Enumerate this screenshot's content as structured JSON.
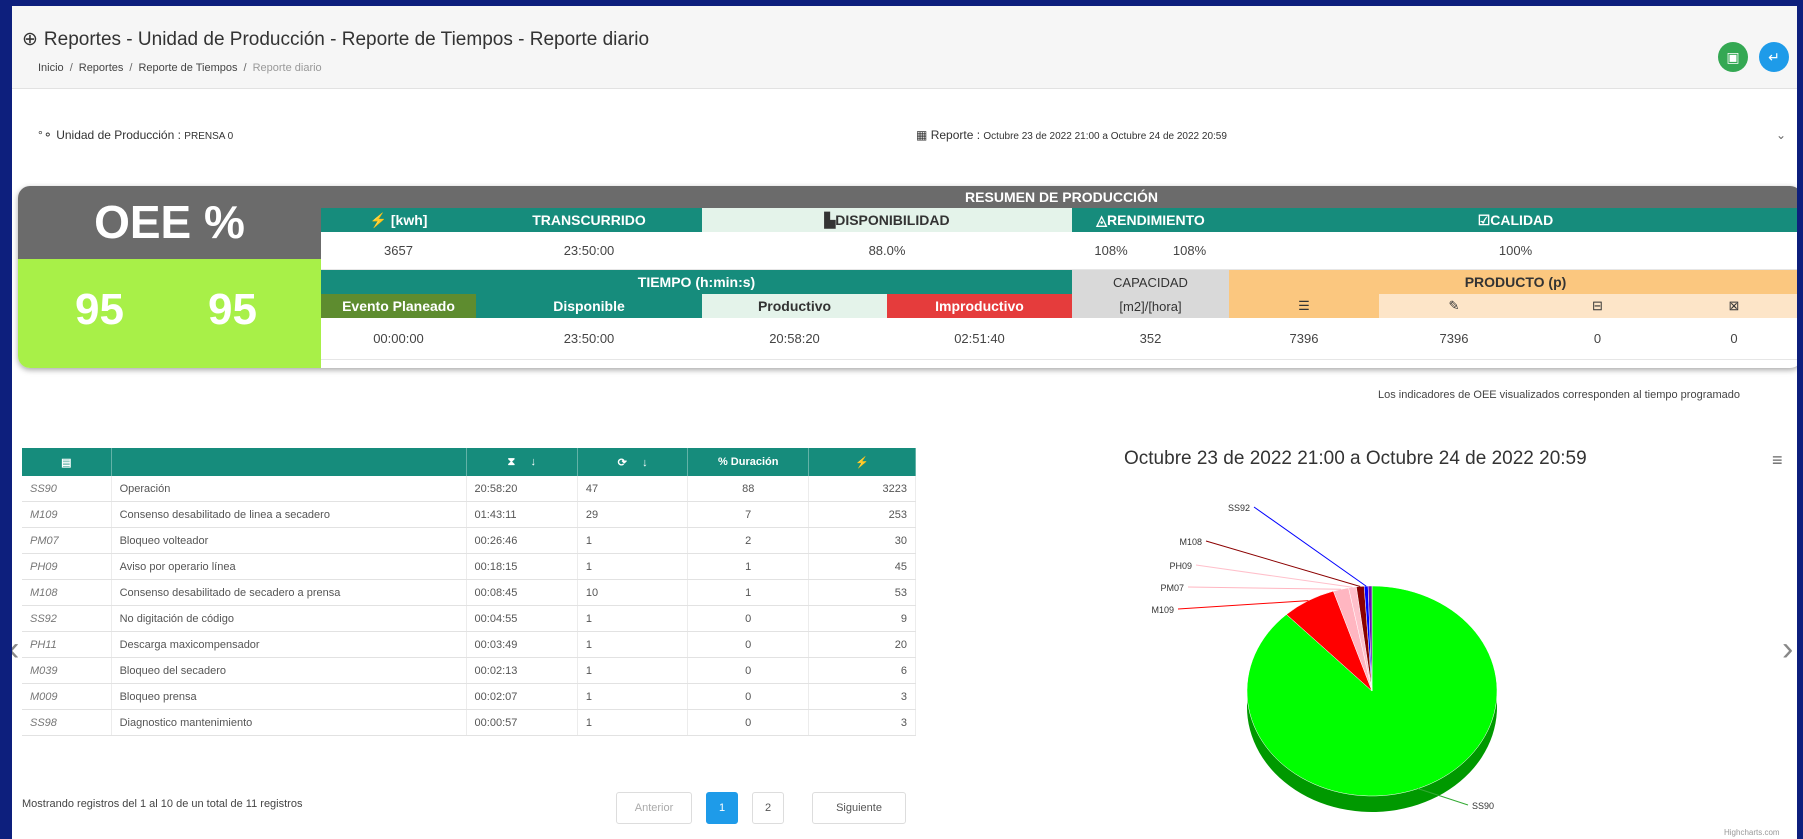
{
  "header": {
    "title": "Reportes - Unidad de Producción - Reporte de Tiempos - Reporte diario",
    "breadcrumb": [
      "Inicio",
      "Reportes",
      "Reporte de Tiempos",
      "Reporte diario"
    ]
  },
  "info": {
    "unit_label": "Unidad de Producción :",
    "unit_value": "PRENSA 0",
    "report_label": "Reporte :",
    "report_value": "Octubre 23 de 2022 21:00 a Octubre 24 de 2022 20:59"
  },
  "summary": {
    "oee_title": "OEE %",
    "oee_values": [
      "95",
      "95"
    ],
    "band_title": "RESUMEN DE PRODUCCIÓN",
    "headers": {
      "energy": "[kwh]",
      "elapsed": "TRANSCURRIDO",
      "availability": "DISPONIBILIDAD",
      "performance": "RENDIMIENTO",
      "quality": "CALIDAD"
    },
    "values": {
      "energy": "3657",
      "elapsed": "23:50:00",
      "availability": "88.0%",
      "performance_a": "108%",
      "performance_b": "108%",
      "quality": "100%"
    },
    "time_title": "TIEMPO (h:min:s)",
    "capacity_title": "CAPACIDAD",
    "capacity_unit": "[m2]/[hora]",
    "product_title": "PRODUCTO (p)",
    "time_headers": {
      "planned": "Evento Planeado",
      "available": "Disponible",
      "productive": "Productivo",
      "unproductive": "Improductivo"
    },
    "time_values": {
      "planned": "00:00:00",
      "available": "23:50:00",
      "productive": "20:58:20",
      "unproductive": "02:51:40"
    },
    "capacity_value": "352",
    "product_values": [
      "7396",
      "7396",
      "0",
      "0"
    ]
  },
  "note": "Los indicadores de OEE visualizados corresponden al tiempo programado",
  "table": {
    "col_pct": "% Duración",
    "rows": [
      {
        "code": "SS90",
        "desc": "Operación",
        "time": "20:58:20",
        "count": "47",
        "pct": "88",
        "energy": "3223"
      },
      {
        "code": "M109",
        "desc": "Consenso desabilitado de linea a secadero",
        "time": "01:43:11",
        "count": "29",
        "pct": "7",
        "energy": "253"
      },
      {
        "code": "PM07",
        "desc": "Bloqueo volteador",
        "time": "00:26:46",
        "count": "1",
        "pct": "2",
        "energy": "30"
      },
      {
        "code": "PH09",
        "desc": "Aviso por operario línea",
        "time": "00:18:15",
        "count": "1",
        "pct": "1",
        "energy": "45"
      },
      {
        "code": "M108",
        "desc": "Consenso desabilitado de secadero a prensa",
        "time": "00:08:45",
        "count": "10",
        "pct": "1",
        "energy": "53"
      },
      {
        "code": "SS92",
        "desc": "No digitación de código",
        "time": "00:04:55",
        "count": "1",
        "pct": "0",
        "energy": "9"
      },
      {
        "code": "PH11",
        "desc": "Descarga maxicompensador",
        "time": "00:03:49",
        "count": "1",
        "pct": "0",
        "energy": "20"
      },
      {
        "code": "M039",
        "desc": "Bloqueo del secadero",
        "time": "00:02:13",
        "count": "1",
        "pct": "0",
        "energy": "6"
      },
      {
        "code": "M009",
        "desc": "Bloqueo prensa",
        "time": "00:02:07",
        "count": "1",
        "pct": "0",
        "energy": "3"
      },
      {
        "code": "SS98",
        "desc": "Diagnostico mantenimiento",
        "time": "00:00:57",
        "count": "1",
        "pct": "0",
        "energy": "3"
      }
    ],
    "showing": "Mostrando registros del 1 al 10 de un total de 11 registros",
    "pager": {
      "prev": "Anterior",
      "p1": "1",
      "p2": "2",
      "next": "Siguiente"
    }
  },
  "chart_data": {
    "type": "pie",
    "title": "Octubre 23 de 2022 21:00 a Octubre 24 de 2022 20:59",
    "credit": "Highcharts.com",
    "slices": [
      {
        "name": "SS90",
        "value": 88,
        "color": "#00ff00"
      },
      {
        "name": "M109",
        "value": 7,
        "color": "#ff0000"
      },
      {
        "name": "PM07",
        "value": 2,
        "color": "#ffb6c1"
      },
      {
        "name": "PH09",
        "value": 1,
        "color": "#ffc0cb"
      },
      {
        "name": "M108",
        "value": 1,
        "color": "#8b0000"
      },
      {
        "name": "SS92",
        "value": 0.5,
        "color": "#0000ff"
      },
      {
        "name": "",
        "value": 0.5,
        "color": "#6a0dad"
      }
    ]
  }
}
